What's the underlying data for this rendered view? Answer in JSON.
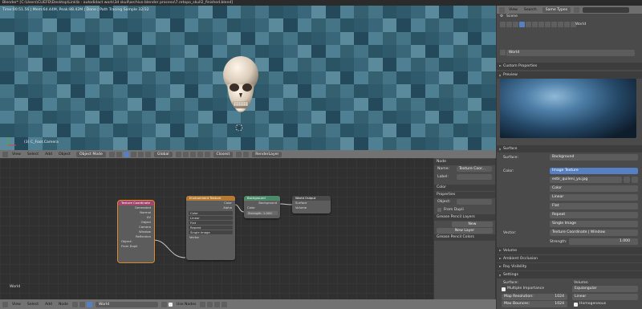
{
  "titlebar": {
    "text": "Blender* [C:\\Users\\CLIEFD\\Desktop\\Link\\b - autodidact work\\3d skull\\archivo blender proceso\\7.retopo_skull2_finished.blend]"
  },
  "viewport": {
    "status": "Time:00:51.56 | Mem:64.44M, Peak:88.42M | Done | Path Tracing Sample 32/32",
    "camera_label": "(3) C_Foot.Camera"
  },
  "view3d_header": {
    "menus": [
      "View",
      "Select",
      "Add",
      "Object"
    ],
    "mode": "Object Mode",
    "pivot": "Global",
    "layer_drop": "Closest",
    "render_layer": "RenderLayer"
  },
  "nodes": {
    "tex_coord": {
      "title": "Texture Coordinate",
      "outputs": [
        "Generated",
        "Normal",
        "UV",
        "Object",
        "Camera",
        "Window",
        "Reflection"
      ],
      "object_label": "Object:",
      "from_dupli": "From Dupli"
    },
    "env_tex": {
      "title": "Environment Texture",
      "outputs": [
        "Color",
        "Alpha"
      ],
      "fields": [
        "Color",
        "Linear",
        "Flat",
        "Repeat",
        "Single Image"
      ],
      "input": "Vector"
    },
    "background": {
      "title": "Background",
      "output": "Background",
      "inputs": [
        "Color"
      ],
      "strength": "Strength: 1.000"
    },
    "world_output": {
      "title": "World Output",
      "inputs": [
        "Surface",
        "Volume"
      ]
    },
    "world_label": "World"
  },
  "npanel": {
    "node_section": "Node",
    "name_label": "Name:",
    "name_value": "Texture Coor...",
    "label_label": "Label:",
    "color_section": "Color",
    "properties_section": "Properties",
    "object_label": "Object:",
    "from_dupli": "From Dupli",
    "gp_layers": "Grease Pencil Layers",
    "new_button": "New",
    "new_layer_button": "New Layer",
    "gp_colors": "Grease Pencil Colors"
  },
  "node_header": {
    "menus": [
      "View",
      "Select",
      "Add",
      "Node"
    ],
    "world_field": "World",
    "use_nodes": "Use Nodes"
  },
  "props": {
    "header_menus": [
      "View",
      "Search"
    ],
    "display_mode": "Same Types",
    "crumb_scene": "Scene",
    "crumb_world": "World",
    "world_field": "World",
    "sections": {
      "custom_properties": "Custom Properties",
      "preview": "Preview",
      "surface": "Surface",
      "volume": "Volume",
      "ambient_occlusion": "Ambient Occlusion",
      "ray_visibility": "Ray Visibility",
      "settings": "Settings"
    },
    "surface_label": "Surface:",
    "surface_value": "Background",
    "color_label": "Color:",
    "color_value": "Image Texture",
    "image_name": "estir_quileni_ya.jpg",
    "image_fields": [
      "Color",
      "Linear",
      "Flat",
      "Repeat",
      "Single Image"
    ],
    "vector_label": "Vector:",
    "vector_value": "Texture Coordinate | Window",
    "strength_label": "Strength:",
    "strength_value": "1.000",
    "settings": {
      "surface_label": "Surface:",
      "multiple_importance": "Multiple Importance",
      "map_resolution_label": "Map Resolution:",
      "map_resolution": "1024",
      "max_bounces_label": "Max Bounces:",
      "max_bounces": "1024",
      "volume_label": "Volume:",
      "volume_sampling": "Equiangular",
      "interpolation": "Linear",
      "homogeneous": "Homogeneous"
    }
  }
}
